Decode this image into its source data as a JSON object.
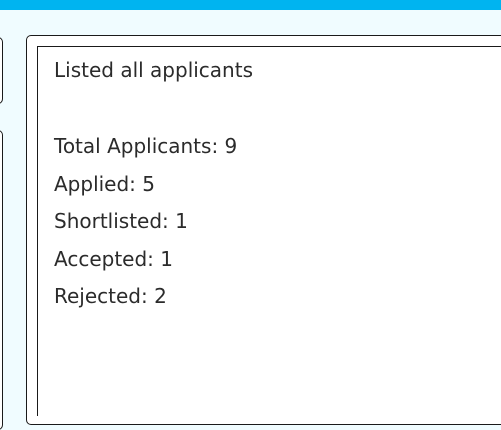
{
  "status_message": "Listed all applicants",
  "stats": [
    "Total Applicants: 9",
    "Applied: 5",
    "Shortlisted: 1",
    "Accepted: 1",
    "Rejected: 2"
  ]
}
